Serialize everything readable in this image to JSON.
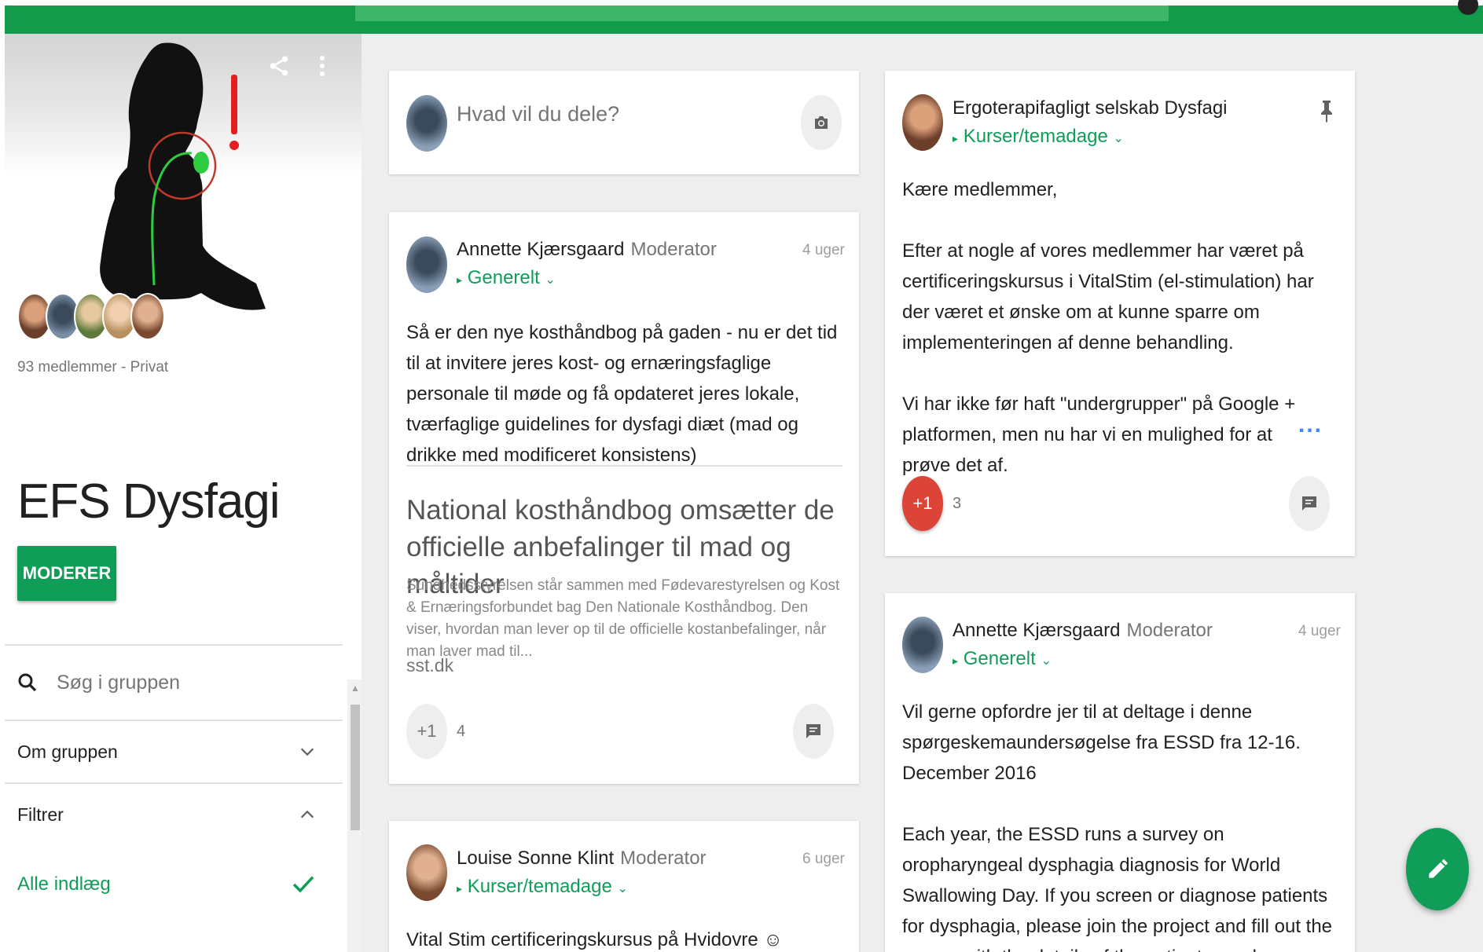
{
  "colors": {
    "topbar": "#129b4a",
    "accent_green": "#0f9d58",
    "plus_one_active": "#db4437",
    "more_dots": "#4285f4",
    "background": "#eeeeee"
  },
  "sidebar": {
    "member_info": "93 medlemmer - Privat",
    "group_title": "EFS Dysfagi",
    "moderate_label": "MODERER",
    "search_placeholder": "Søg i gruppen",
    "about_label": "Om gruppen",
    "filter_label": "Filtrer",
    "filter_selected": "Alle indlæg",
    "icons": [
      "share-icon",
      "more-vert-icon",
      "search-icon",
      "chevron-down-icon",
      "chevron-up-icon",
      "check-icon"
    ]
  },
  "composer": {
    "placeholder": "Hvad vil du dele?",
    "icon": "camera-icon"
  },
  "posts": [
    {
      "author": "Annette Kjærsgaard",
      "role": "Moderator",
      "category": "Generelt",
      "time": "4 uger",
      "body": "Så er den nye kosthåndbog på gaden - nu er det tid til at invitere jeres kost- og ernæringsfaglige personale til møde og få opdateret jeres lokale, tværfaglige guidelines for dysfagi diæt (mad og drikke med modificeret konsistens)",
      "link_title": "National kosthåndbog omsætter de officielle anbefalinger til mad og måltider",
      "link_desc": "Sundhedsstyrelsen står sammen med Fødevarestyrelsen og Kost & Ernæringsforbundet bag Den Nationale Kosthåndbog. Den viser, hvordan man lever op til de officielle kostanbefalinger, når man laver mad til...",
      "link_domain": "sst.dk",
      "plus_label": "+1",
      "plus_count": "4"
    },
    {
      "author": "Louise Sonne Klint",
      "role": "Moderator",
      "category": "Kurser/temadage",
      "time": "6 uger",
      "body": "Vital Stim certificeringskursus på Hvidovre ☺"
    },
    {
      "author": "Ergoterapifagligt selskab Dysfagi",
      "role": "",
      "category": "Kurser/temadage",
      "time": "",
      "greeting": "Kære medlemmer,",
      "body": "Efter at nogle af vores medlemmer har været på certificeringskursus i VitalStim (el-stimulation) har der været et ønske om at kunne sparre om implementeringen af denne behandling.",
      "body2": "Vi har ikke før haft \"undergrupper\" på Google + platformen, men nu har vi en mulighed for at prøve det af.",
      "more": "...",
      "plus_label": "+1",
      "plus_count": "3",
      "pinned": true
    },
    {
      "author": "Annette Kjærsgaard",
      "role": "Moderator",
      "category": "Generelt",
      "time": "4 uger",
      "body": "Vil gerne opfordre jer til at deltage i denne spørgeskemaundersøgelse fra ESSD fra 12-16. December 2016",
      "body2": "Each year, the ESSD runs a survey on oropharyngeal dysphagia diagnosis for World Swallowing Day. If you screen or diagnose patients for dysphagia, please join the project and fill out the survey with the details of the patients you have"
    }
  ],
  "fab_icon": "edit-icon"
}
